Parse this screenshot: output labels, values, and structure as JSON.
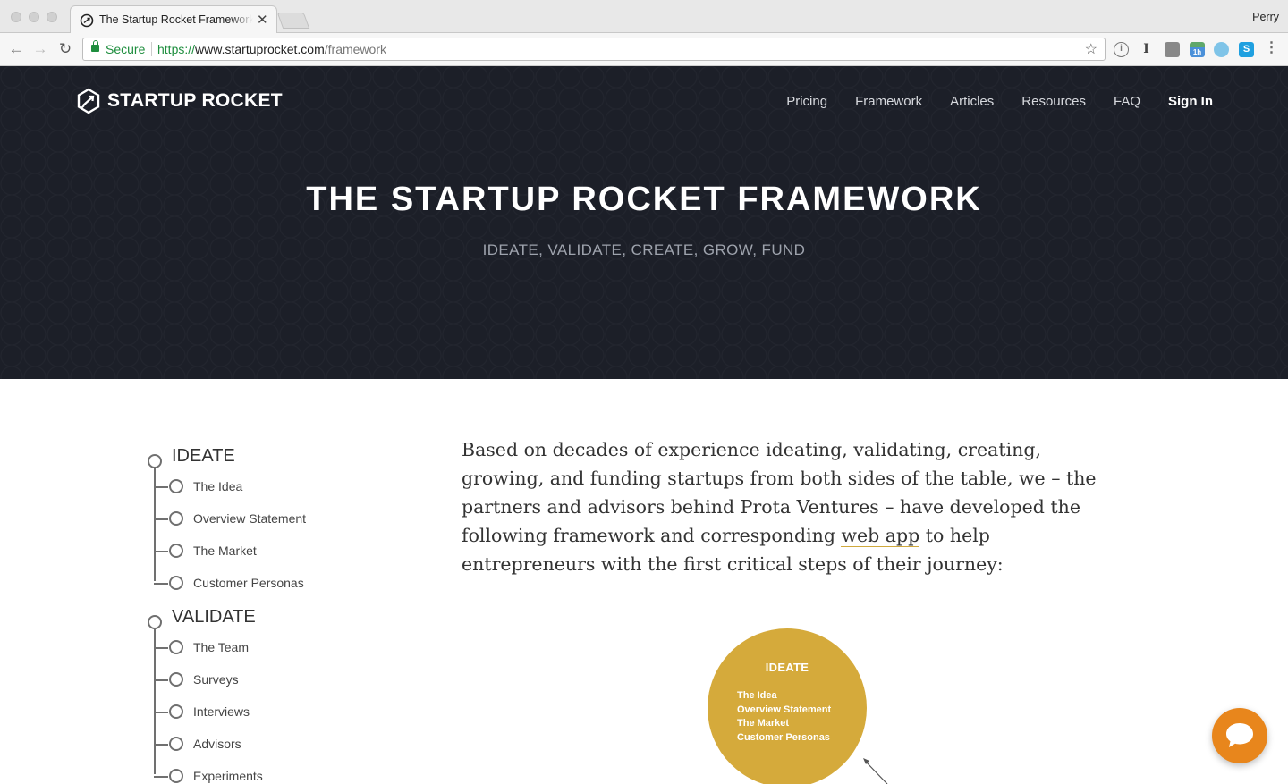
{
  "browser": {
    "tab_title": "The Startup Rocket Framework",
    "profile_name": "Perry",
    "secure_label": "Secure",
    "url_protocol": "https://",
    "url_host": "www.startuprocket.com",
    "url_path": "/framework",
    "extensions": [
      {
        "name": "1password-icon",
        "label": ""
      },
      {
        "name": "instapaper-icon",
        "label": "I"
      },
      {
        "name": "pocket-icon",
        "label": ""
      },
      {
        "name": "calendar-icon",
        "label": "1h"
      },
      {
        "name": "globe-icon",
        "label": ""
      },
      {
        "name": "skype-icon",
        "label": "S"
      }
    ]
  },
  "site": {
    "logo_text": "STARTUP ROCKET",
    "nav": [
      "Pricing",
      "Framework",
      "Articles",
      "Resources",
      "FAQ",
      "Sign In"
    ]
  },
  "hero": {
    "title": "THE STARTUP ROCKET FRAMEWORK",
    "subtitle": "IDEATE, VALIDATE, CREATE, GROW, FUND"
  },
  "tree": [
    {
      "label": "IDEATE",
      "items": [
        "The Idea",
        "Overview Statement",
        "The Market",
        "Customer Personas"
      ]
    },
    {
      "label": "VALIDATE",
      "items": [
        "The Team",
        "Surveys",
        "Interviews",
        "Advisors",
        "Experiments"
      ]
    }
  ],
  "intro": {
    "part1": "Based on decades of experience ideating, validating, creating, growing, and funding startups from both sides of the table, we – the partners and advisors behind ",
    "link1": "Prota Ventures",
    "part2": " – have developed the following framework and corresponding ",
    "link2": "web app",
    "part3": " to help entrepreneurs with the first critical steps of their journey:"
  },
  "diagram": {
    "title": "IDEATE",
    "items": [
      "The Idea",
      "Overview Statement",
      "The Market",
      "Customer Personas"
    ],
    "color": "#d5aa3b"
  },
  "colors": {
    "hero_bg": "#1c1f28",
    "accent": "#d5aa3b",
    "chat": "#e8861c"
  }
}
